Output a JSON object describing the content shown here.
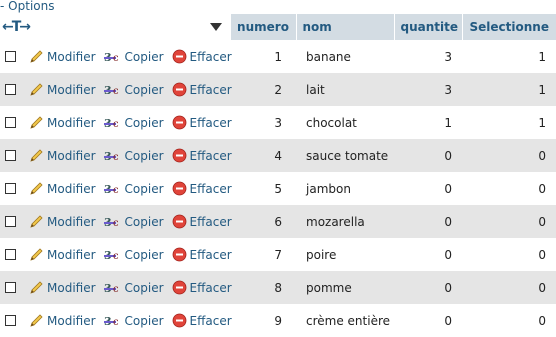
{
  "options_label": "Options",
  "columns": {
    "numero": "numero",
    "nom": "nom",
    "quantite": "quantite",
    "selectionne": "Selectionne"
  },
  "actions": {
    "edit": "Modifier",
    "copy": "Copier",
    "delete": "Effacer"
  },
  "rows": [
    {
      "numero": "1",
      "nom": "banane",
      "quantite": "3",
      "selectionne": "1"
    },
    {
      "numero": "2",
      "nom": "lait",
      "quantite": "3",
      "selectionne": "1"
    },
    {
      "numero": "3",
      "nom": "chocolat",
      "quantite": "1",
      "selectionne": "1"
    },
    {
      "numero": "4",
      "nom": "sauce tomate",
      "quantite": "0",
      "selectionne": "0"
    },
    {
      "numero": "5",
      "nom": "jambon",
      "quantite": "0",
      "selectionne": "0"
    },
    {
      "numero": "6",
      "nom": "mozarella",
      "quantite": "0",
      "selectionne": "0"
    },
    {
      "numero": "7",
      "nom": "poire",
      "quantite": "0",
      "selectionne": "0"
    },
    {
      "numero": "8",
      "nom": "pomme",
      "quantite": "0",
      "selectionne": "0"
    },
    {
      "numero": "9",
      "nom": "crème entière",
      "quantite": "0",
      "selectionne": "0"
    }
  ],
  "colors": {
    "header_bg": "#d3dce3",
    "link": "#235a81",
    "row_alt": "#e5e5e5"
  }
}
